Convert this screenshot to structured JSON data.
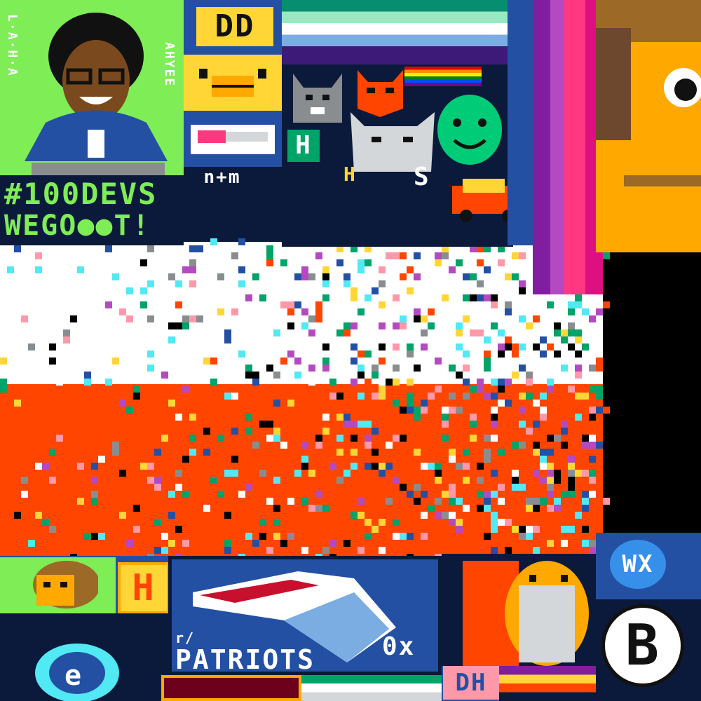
{
  "canvas": {
    "colors": {
      "flag_white": "#ffffff",
      "flag_orange": "#ff4500",
      "dark_navy": "#0b1a3a",
      "blue": "#2450a4",
      "light_green": "#7eed56",
      "green": "#00a368",
      "yellow": "#ffd635",
      "pink": "#ff3881",
      "black": "#000000",
      "gold": "#ffa800"
    }
  },
  "art": {
    "hundred_devs": {
      "line1": "#100DEVS",
      "line2": "WEGO●●T!",
      "side_left": "L·A·H·A",
      "side_right": "AHYEE"
    },
    "dd_badge": {
      "text": "DD"
    },
    "ntm_tag": {
      "text": "n+m"
    },
    "h_badge_top": {
      "text": "H"
    },
    "h_badge_small": {
      "text": "H"
    },
    "s_letter": {
      "text": "S"
    },
    "patriots": {
      "text": "PATRIOTS",
      "prefix": "r/",
      "suffix": "0x"
    },
    "h_badge_bottom": {
      "text": "H"
    },
    "wx_badge": {
      "text": "WX"
    },
    "b_circle": {
      "text": "B"
    },
    "dh_tag": {
      "text": "DH"
    }
  }
}
